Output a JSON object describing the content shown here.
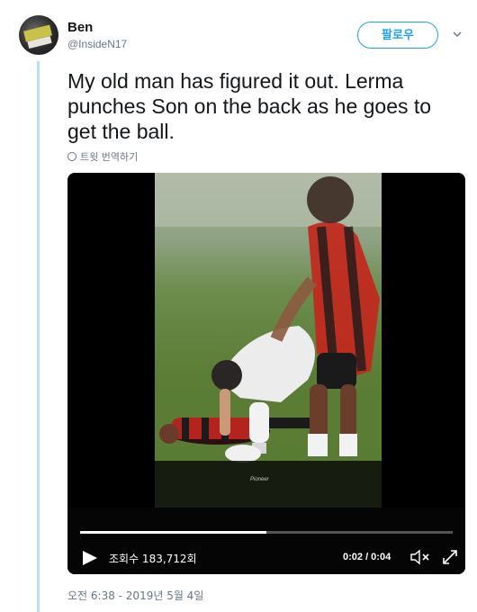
{
  "author": {
    "name": "Ben",
    "handle": "@InsideN17"
  },
  "follow_label": "팔로우",
  "tweet": {
    "text": "My old man has figured it out. Lerma punches Son on the back as he goes to get the ball.",
    "translate_label": "트윗 번역하기",
    "timestamp": "오전 6:38 - 2019년 5월 4일"
  },
  "video": {
    "views_label": "조회수 183,712회",
    "time_label": "0:02 / 0:04",
    "progress": 0.5,
    "overlay_text": "Pioneer"
  },
  "colors": {
    "accent": "#1da1f2",
    "thread_line": "#b7e0f8"
  }
}
